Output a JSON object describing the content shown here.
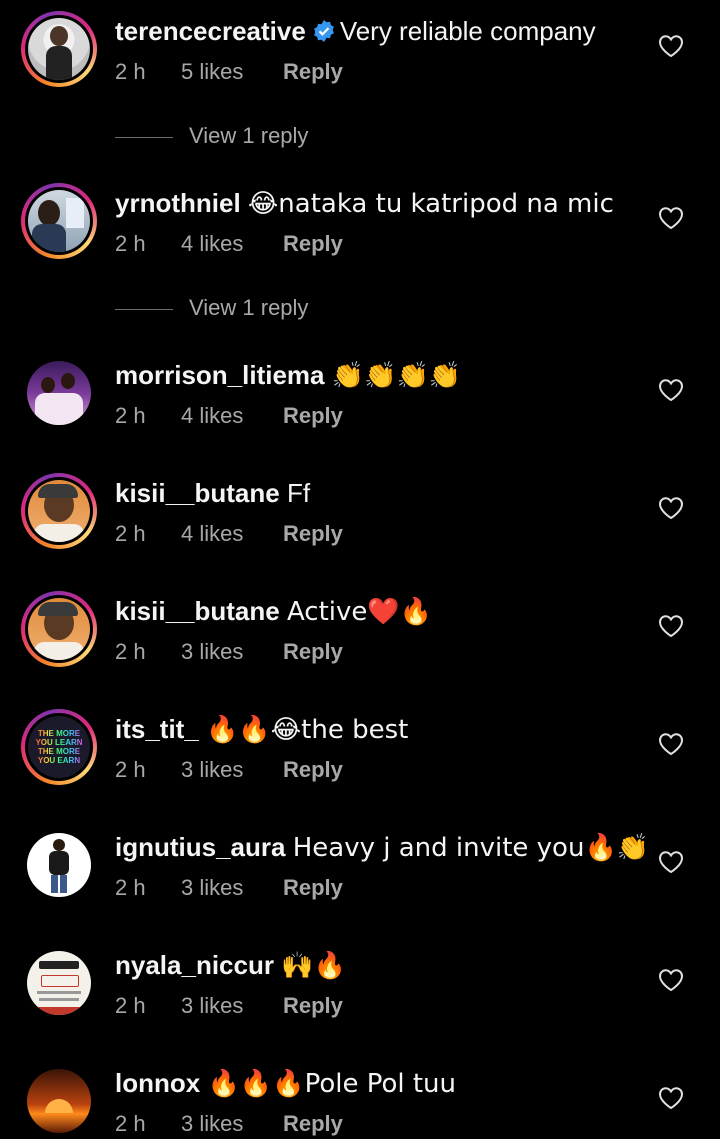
{
  "icons": {
    "like": "heart-outline-icon",
    "verified": "verified-badge-icon"
  },
  "colors": {
    "background": "#000000",
    "primary_text": "#f5f5f5",
    "secondary_text": "#a8a8a8",
    "verified": "#3897f0"
  },
  "comments": [
    {
      "username": "terencecreative",
      "verified": true,
      "text": "Very reliable company",
      "time": "2 h",
      "likes": "5 likes",
      "reply": "Reply",
      "view_replies": "View 1 reply"
    },
    {
      "username": "yrnothniel",
      "text": "😂nataka tu katripod na mic",
      "time": "2 h",
      "likes": "4 likes",
      "reply": "Reply",
      "view_replies": "View 1 reply"
    },
    {
      "username": "morrison_litiema",
      "text": "👏👏👏👏",
      "time": "2 h",
      "likes": "4 likes",
      "reply": "Reply"
    },
    {
      "username": "kisii__butane",
      "text": "Ff",
      "time": "2 h",
      "likes": "4 likes",
      "reply": "Reply"
    },
    {
      "username": "kisii__butane",
      "text": "Active❤️🔥",
      "time": "2 h",
      "likes": "3 likes",
      "reply": "Reply"
    },
    {
      "username": "its_tit_",
      "text": "🔥🔥😂the best",
      "time": "2 h",
      "likes": "3 likes",
      "reply": "Reply",
      "avatar_text": "THE MORE YOU LEARN THE MORE YOU EARN"
    },
    {
      "username": "ignutius_aura",
      "text": "Heavy j and invite you🔥👏",
      "time": "2 h",
      "likes": "3 likes",
      "reply": "Reply"
    },
    {
      "username": "nyala_niccur",
      "text": "🙌🔥",
      "time": "2 h",
      "likes": "3 likes",
      "reply": "Reply"
    },
    {
      "username": "lonnox",
      "text": "🔥🔥🔥Pole Pol tuu",
      "time": "2 h",
      "likes": "3 likes",
      "reply": "Reply"
    }
  ]
}
